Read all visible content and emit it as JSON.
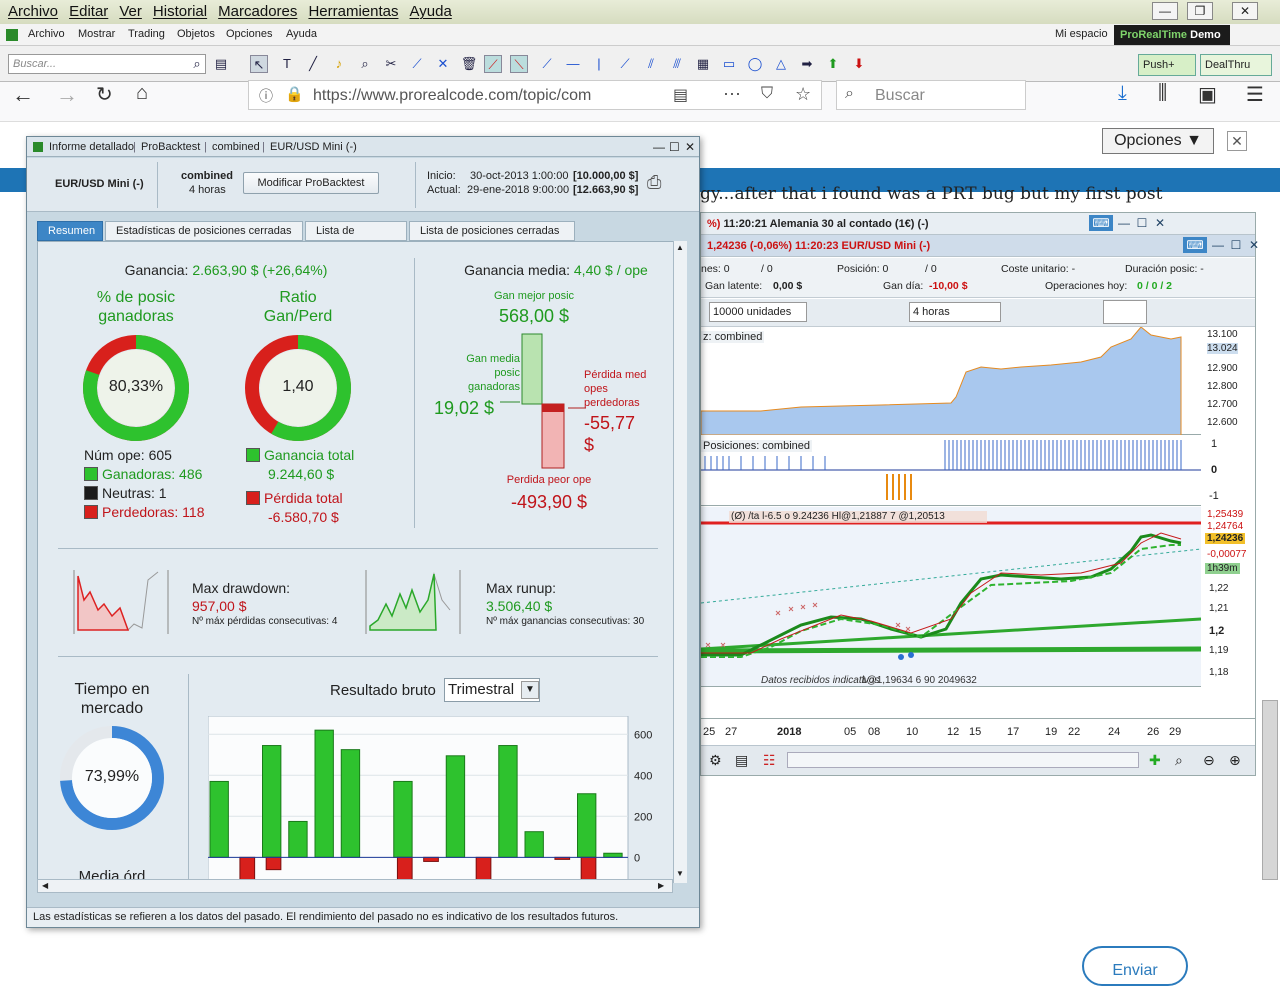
{
  "os_menu": [
    "Archivo",
    "Editar",
    "Ver",
    "Historial",
    "Marcadores",
    "Herramientas",
    "Ayuda"
  ],
  "prt_menu": [
    "Archivo",
    "Mostrar",
    "Trading",
    "Objetos",
    "Opciones",
    "Ayuda"
  ],
  "prt_right": {
    "mi_espacio": "Mi espacio",
    "brand": "ProRealTime",
    "brand_suffix": "Demo",
    "push": "Push+",
    "dealthru": "DealThru"
  },
  "search_placeholder": "Buscar...",
  "firefox": {
    "url": "https://www.prorealcode.com/topic/com",
    "search_placeholder": "Buscar"
  },
  "page": {
    "opciones": "Opciones ▼",
    "text_fragment": "gy...after that i found was a PRT bug but my first post",
    "enviar": "Enviar"
  },
  "chart": {
    "window1_title": "11:20:21  Alemania 30 al contado (1€) (-)",
    "window2_title": "1,24236 (-0,06%)   11:20:23  EUR/USD Mini (-)",
    "row1": {
      "l1": "nes: 0",
      "l1b": "/ 0",
      "posicion": "Posición: 0",
      "posicion_b": "/ 0",
      "coste": "Coste unitario:  -",
      "duracion": "Duración posic:  -"
    },
    "row2": {
      "latente_label": "Gan latente:",
      "latente": "0,00 $",
      "dia_label": "Gan día:",
      "dia": "-10,00 $",
      "hoy_label": "Operaciones hoy:",
      "hoy": "0 / 0 / 2"
    },
    "units": "10000 unidades",
    "tf": "4 horas",
    "equity_label": "z: combined",
    "equity_scale": [
      "13.100",
      "13.024",
      "12.900",
      "12.800",
      "12.700",
      "12.600"
    ],
    "pos_label": "Posiciones: combined",
    "pos_scale": [
      "1",
      "0",
      "-1"
    ],
    "price_scale": [
      "1,25439",
      "1,24764",
      "1,24236",
      "-0,00077",
      "1h39m",
      "1,22",
      "1,21",
      "1,2",
      "1,19",
      "1,18"
    ],
    "price_overlay": "(Ø) /ta l-6.5 o 9.24236 Hl@1,21887 7 @1,20513",
    "bottom_label1": "Datos recibidos indicativos",
    "bottom_label2": "1@1,19634  6 90 2049632",
    "xaxis": [
      "25",
      "27",
      "2018",
      "05",
      "08",
      "10",
      "12",
      "15",
      "17",
      "19",
      "22",
      "24",
      "26",
      "29"
    ]
  },
  "report": {
    "title_parts": [
      "Informe detallado",
      "ProBacktest",
      "combined",
      "EUR/USD Mini (-)"
    ],
    "instrument": "EUR/USD Mini (-)",
    "strategy": "combined",
    "timeframe": "4 horas",
    "modify_btn": "Modificar ProBacktest",
    "inicio_label": "Inicio:",
    "inicio": "30-oct-2013 1:00:00",
    "inicio_val": "[10.000,00 $]",
    "actual_label": "Actual:",
    "actual": "29-ene-2018 9:00:00",
    "actual_val": "[12.663,90 $]",
    "tabs": [
      "Resumen",
      "Estadísticas de posiciones cerradas",
      "Lista de órdenes",
      "Lista de posiciones cerradas"
    ],
    "ganancia_label": "Ganancia:",
    "ganancia": "2.663,90 $ (+26,64%)",
    "pct_posic_label": "% de posic ganadoras",
    "pct_posic": "80,33%",
    "ratio_label": "Ratio Gan/Perd",
    "ratio": "1,40",
    "num_ope": "Núm ope: 605",
    "ganadoras": "Ganadoras: 486",
    "neutras": "Neutras: 1",
    "perdedoras": "Perdedoras: 118",
    "ganancia_total_label": "Ganancia total",
    "ganancia_total": "9.244,60 $",
    "perdida_total_label": "Pérdida total",
    "perdida_total": "-6.580,70 $",
    "ganancia_media_label": "Ganancia media:",
    "ganancia_media": "4,40 $ / ope",
    "gan_mejor_label": "Gan mejor posic",
    "gan_mejor": "568,00 $",
    "gan_media_posic_label": "Gan media posic ganadoras",
    "gan_media_posic": "19,02 $",
    "perdida_med_label": "Pérdida med opes perdedoras",
    "perdida_med": "-55,77 $",
    "perdida_peor_label": "Perdida peor ope",
    "perdida_peor": "-493,90 $",
    "max_drawdown_label": "Max drawdown:",
    "max_drawdown": "957,00 $",
    "max_perdidas_consec": "Nº máx pérdidas consecutivas: 4",
    "max_runup_label": "Max runup:",
    "max_runup": "3.506,40 $",
    "max_ganancias_consec": "Nº máx ganancias consecutivas: 30",
    "tiempo_mercado_label": "Tiempo en mercado",
    "tiempo_mercado": "73,99%",
    "media_ord_label": "Media órd",
    "resultado_bruto_label": "Resultado bruto",
    "resultado_period": "Trimestral",
    "footer": "Las estadísticas se refieren a los datos del pasado. El rendimiento del pasado no es indicativo de los resultados futuros."
  },
  "chart_data": {
    "type": "bar",
    "title": "Resultado bruto",
    "ylim": [
      -130,
      650
    ],
    "yticks": [
      0,
      200,
      400,
      600
    ],
    "gains": [
      370,
      0,
      545,
      175,
      620,
      525,
      0,
      370,
      0,
      495,
      0,
      545,
      125,
      0,
      310,
      20
    ],
    "losses": [
      0,
      -120,
      -60,
      0,
      0,
      0,
      0,
      -120,
      -20,
      0,
      -125,
      0,
      0,
      -10,
      -120,
      0
    ]
  },
  "colors": {
    "accent": "#3d86c6",
    "gain": "#2ec22e",
    "loss": "#d8201c",
    "panel": "#e3ebf1"
  }
}
